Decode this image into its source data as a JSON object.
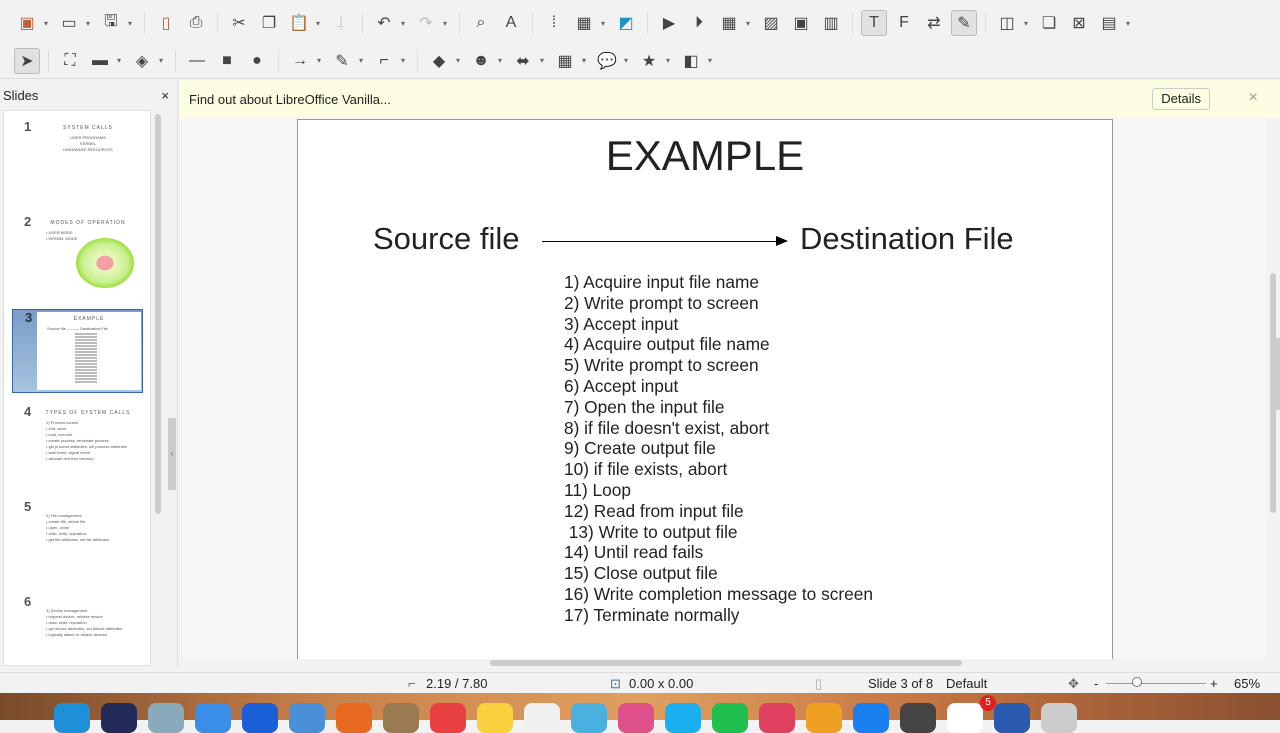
{
  "toolbar1": [
    "presentation-icon",
    "open-icon",
    "save-icon",
    "export-pdf-icon",
    "print-icon",
    "cut-icon",
    "copy-icon",
    "paste-icon",
    "clone-icon",
    "undo-icon",
    "redo-icon",
    "find-icon",
    "spelling-icon",
    "grid-icon",
    "layout-icon",
    "comment-icon",
    "start-slideshow-icon",
    "from-current-icon",
    "table-icon",
    "image-icon",
    "media-icon",
    "chart-icon",
    "textbox-icon",
    "fontwork-icon",
    "transitions-icon",
    "draw-functions-icon",
    "new-slide-icon",
    "duplicate-slide-icon",
    "delete-slide-icon",
    "slide-layout-icon"
  ],
  "toolbar2": [
    "select-icon",
    "zoom-pan-icon",
    "line-color-icon",
    "fill-color-icon",
    "line-icon",
    "rectangle-icon",
    "ellipse-icon",
    "arrow-icon",
    "curve-icon",
    "connector-icon",
    "basic-shapes-icon",
    "symbol-shapes-icon",
    "block-arrows-icon",
    "flowchart-icon",
    "callout-icon",
    "stars-icon",
    "3d-objects-icon"
  ],
  "slides_panel": {
    "title": "Slides",
    "close": "×"
  },
  "thumbs": [
    {
      "num": "1",
      "title": "SYSTEM CALLS",
      "lines": [
        "USER PROGRAMS",
        "KERNEL",
        "HARDWARE RESOURCES"
      ]
    },
    {
      "num": "2",
      "title": "MODES OF OPERATION",
      "lines": [
        "• USER MODE",
        "• KERNEL MODE"
      ]
    },
    {
      "num": "3",
      "title": "EXAMPLE",
      "lines": [
        "Source file ——— Destination File"
      ]
    },
    {
      "num": "4",
      "title": "TYPES OF SYSTEM CALLS",
      "lines": [
        "1) Process control",
        "• end, abort",
        "• load, execute",
        "• create process, terminate process",
        "• get process attributes, set process attributes",
        "• wait event, signal event",
        "• allocate and free memory"
      ]
    },
    {
      "num": "5",
      "title": "",
      "lines": [
        "2) File management",
        "• create file, delete file",
        "• open, close",
        "• read, write, reposition",
        "• get file attributes, set file attributes"
      ]
    },
    {
      "num": "6",
      "title": "",
      "lines": [
        "3) Device management",
        "• request device, release device",
        "• read, write, reposition",
        "• get device attributes, set device attributes",
        "• logically attach or detach devices"
      ]
    }
  ],
  "infobar": {
    "message": "Find out about LibreOffice Vanilla...",
    "details": "Details",
    "close": "×"
  },
  "slide": {
    "title": "EXAMPLE",
    "source": "Source file",
    "destination": "Destination File",
    "steps": [
      "1) Acquire input file name",
      "2) Write prompt to screen",
      "3) Accept input",
      "4) Acquire output file name",
      "5) Write prompt to screen",
      "6) Accept input",
      "7) Open the input file",
      "8) if file doesn't exist, abort",
      "9) Create output file",
      "10) if file exists, abort",
      "11) Loop",
      "12) Read from input file",
      " 13) Write to output file",
      "14) Until read fails",
      "15) Close output file",
      "16) Write completion message to screen",
      "17) Terminate normally"
    ]
  },
  "status": {
    "position": "2.19 / 7.80",
    "size": "0.00 x 0.00",
    "slide": "Slide 3 of 8",
    "master": "Default",
    "zoom": "65%",
    "zoom_minus": "-",
    "zoom_plus": "+"
  },
  "dock": {
    "badge": "5"
  }
}
